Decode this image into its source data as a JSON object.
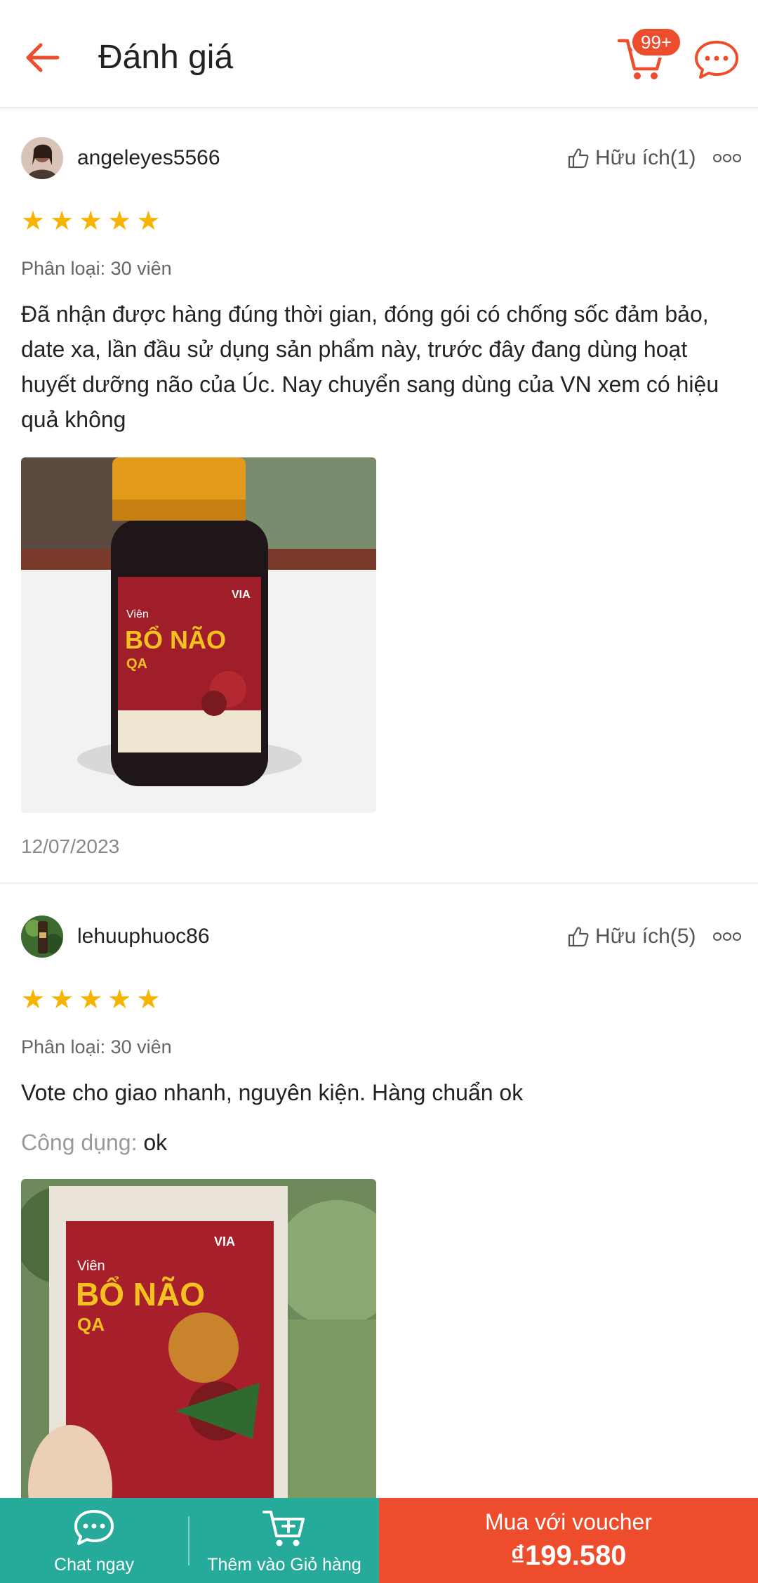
{
  "header": {
    "title": "Đánh giá",
    "cart_badge": "99+",
    "back_icon": "arrow-left-icon",
    "cart_icon": "cart-icon",
    "chat_icon": "chat-bubble-icon",
    "accent_color": "#ee4d2d"
  },
  "reviews": [
    {
      "username": "angeleyes5566",
      "helpful": "Hữu ích(1)",
      "rating": 5,
      "variant": "Phân loại: 30 viên",
      "text": "Đã nhận được hàng đúng thời gian, đóng gói có chống sốc đảm bảo, date xa, lần đầu sử dụng sản phẩm này, trước đây đang dùng hoạt huyết dưỡng não của Úc. Nay chuyển sang dùng của VN xem có hiệu quả không",
      "date": "12/07/2023",
      "photo_label_brand": "VIA",
      "photo_label_small": "Viên",
      "photo_label_big": "BỔ NÃO",
      "photo_label_qa": "QA"
    },
    {
      "username": "lehuuphuoc86",
      "helpful": "Hữu ích(5)",
      "rating": 5,
      "variant": "Phân loại: 30 viên",
      "text": "Vote cho giao nhanh, nguyên kiện. Hàng chuẩn ok",
      "usage_label": "Công dụng:",
      "usage_value": "ok",
      "photo_label_brand": "VIA",
      "photo_label_small": "Viên",
      "photo_label_big": "BỔ NÃO",
      "photo_label_qa": "QA"
    }
  ],
  "bottom_bar": {
    "chat_label": "Chat ngay",
    "add_cart_label": "Thêm vào Giỏ hàng",
    "buy_label": "Mua với voucher",
    "price": "₫199.580",
    "left_color": "#26aa99",
    "right_color": "#ee4d2d"
  }
}
